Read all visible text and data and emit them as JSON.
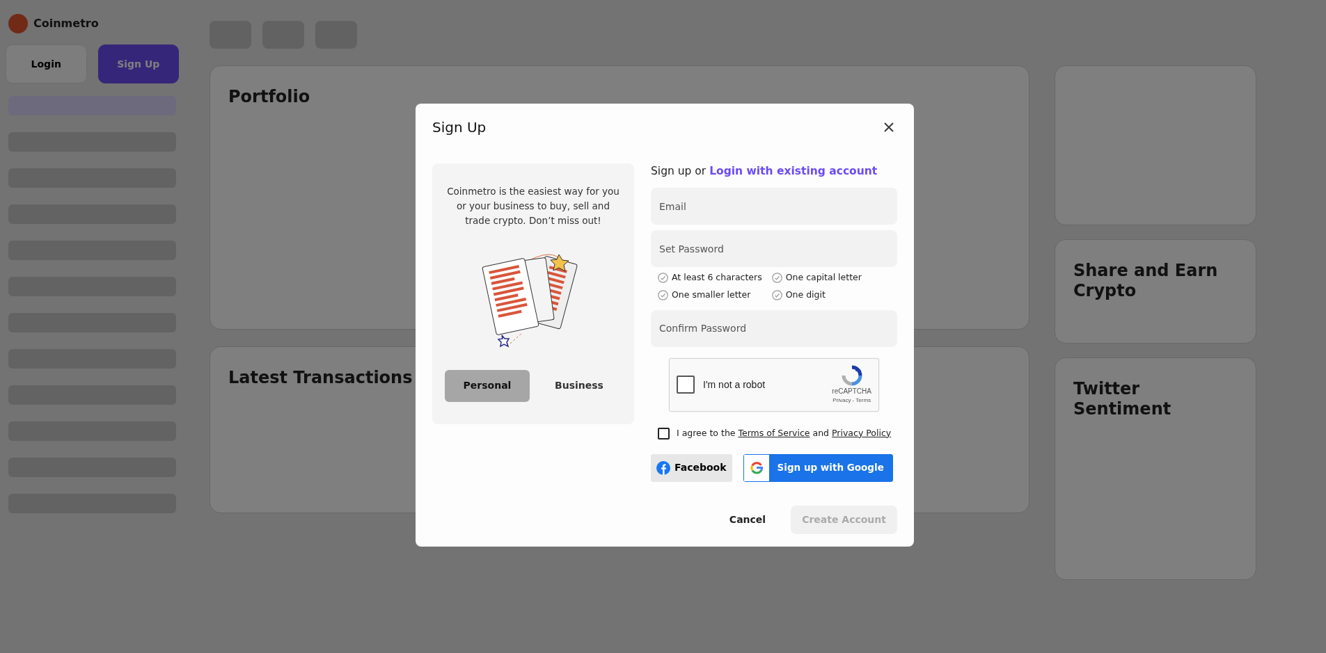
{
  "background": {
    "brand": "Coinmetro",
    "sidebar_buttons": [
      {
        "label": "Login",
        "selected": false
      },
      {
        "label": "Sign Up",
        "selected": true
      }
    ],
    "main_panels": [
      "Portfolio",
      "Latest Transactions"
    ],
    "side_panels": [
      "Share and Earn Crypto",
      "Twitter Sentiment"
    ]
  },
  "modal": {
    "title": "Sign Up",
    "intro": "Coinmetro is the easiest way for you or your business to buy, sell and trade crypto. Don’t miss out!",
    "account_types": [
      {
        "label": "Personal",
        "selected": true
      },
      {
        "label": "Business",
        "selected": false
      }
    ],
    "lead": "Sign up or",
    "login_link": "Login with existing account",
    "fields": [
      {
        "placeholder": "Email"
      },
      {
        "placeholder": "Set Password",
        "rules": [
          {
            "label": "At least 6 characters",
            "met": false
          },
          {
            "label": "One capital letter",
            "met": false
          },
          {
            "label": "One smaller letter",
            "met": false
          },
          {
            "label": "One digit",
            "met": false
          }
        ]
      },
      {
        "placeholder": "Confirm Password"
      }
    ],
    "captcha": {
      "label": "I'm not a robot",
      "checked": false,
      "brand": "reCAPTCHA",
      "links": "Privacy - Terms"
    },
    "agree": {
      "checked": false,
      "parts": [
        {
          "text": "I agree to the",
          "link": false
        },
        {
          "text": "Terms of Service",
          "link": true
        },
        {
          "text": "and",
          "link": false
        },
        {
          "text": "Privacy Policy",
          "link": true
        }
      ]
    },
    "social": [
      {
        "kind": "facebook",
        "label": "Facebook"
      },
      {
        "kind": "google",
        "label": "Sign up with Google"
      }
    ],
    "footer": [
      {
        "label": "Cancel",
        "disabled": false
      },
      {
        "label": "Create Account",
        "disabled": true
      }
    ]
  }
}
